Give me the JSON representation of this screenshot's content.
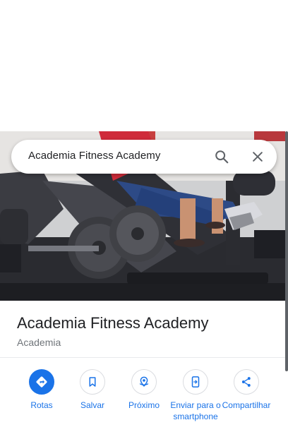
{
  "search": {
    "query": "Academia Fitness Academy"
  },
  "place": {
    "title": "Academia Fitness Academy",
    "category": "Academia"
  },
  "actions": [
    {
      "label": "Rotas",
      "icon": "directions-icon"
    },
    {
      "label": "Salvar",
      "icon": "bookmark-icon"
    },
    {
      "label": "Próximo",
      "icon": "nearby-icon"
    },
    {
      "label": "Enviar para o smartphone",
      "icon": "send-to-phone-icon"
    },
    {
      "label": "Compartilhar",
      "icon": "share-icon"
    }
  ],
  "colors": {
    "accent": "#1a73e8",
    "title_text": "#202124",
    "secondary_text": "#70757a",
    "divider": "#e8eaed"
  }
}
